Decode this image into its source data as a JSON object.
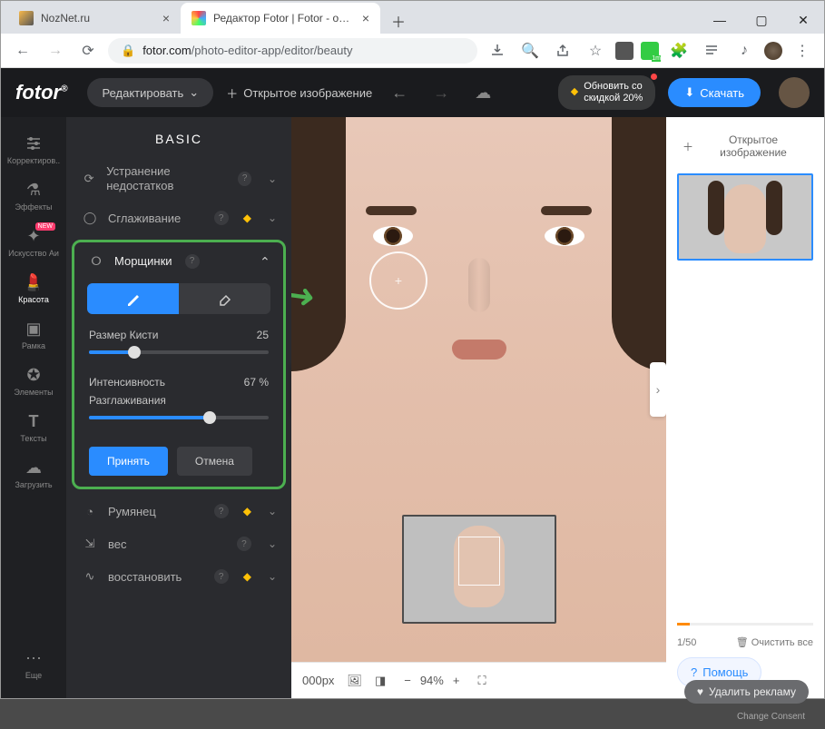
{
  "window": {
    "tab1": "NozNet.ru",
    "tab2": "Редактор Fotor | Fotor - онлай"
  },
  "url": {
    "host": "fotor.com",
    "path": "/photo-editor-app/editor/beauty"
  },
  "header": {
    "logo": "fotor",
    "edit": "Редактировать",
    "open": "Открытое изображение",
    "promo_l1": "Обновить со",
    "promo_l2": "скидкой 20%",
    "download": "Скачать"
  },
  "rail": {
    "adjust": "Корректиров..",
    "effects": "Эффекты",
    "ai": "Искусство Аи",
    "ai_badge": "NEW",
    "beauty": "Красота",
    "frame": "Рамка",
    "elements": "Элементы",
    "texts": "Тексты",
    "download": "Загрузить",
    "more": "Еще"
  },
  "panel": {
    "title": "BASIC",
    "blemish": "Устранение недостатков",
    "smooth": "Сглаживание",
    "wrinkles": "Морщинки",
    "brush_size": "Размер Кисти",
    "brush_val": "25",
    "intensity": "Интенсивность",
    "intensity_val": "67 %",
    "smoothing": "Разглаживания",
    "apply": "Принять",
    "cancel": "Отмена",
    "blush": "Румянец",
    "weight": "вес",
    "restore": "восстановить"
  },
  "canvas": {
    "dims": "000px",
    "zoom": "94%"
  },
  "right": {
    "open": "Открытое изображение",
    "count": "1/50",
    "clear": "Очистить все",
    "help": "Помощь"
  },
  "footer": {
    "remove_ads": "Удалить рекламу",
    "consent": "Change Consent"
  }
}
